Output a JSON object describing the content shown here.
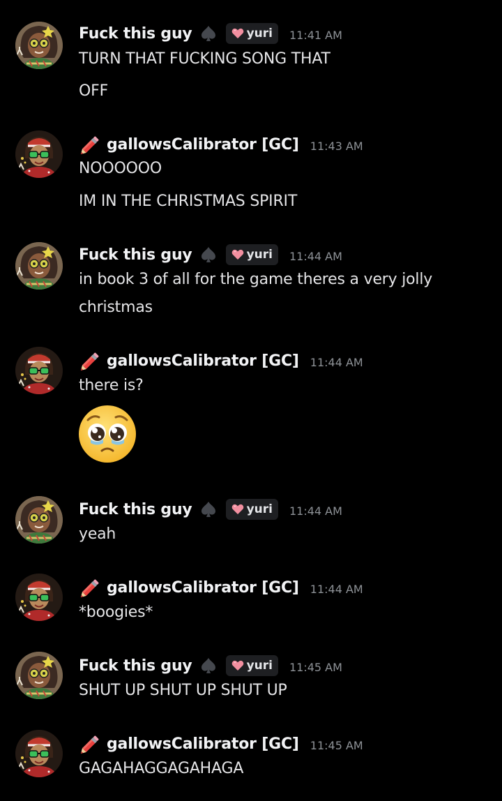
{
  "colors": {
    "background": "#000000",
    "text": "#e6e6e8",
    "timestamp": "#8e9297",
    "tag_bg": "#1e1f22",
    "heart": "#f28fa0",
    "pencil": "#e8413e"
  },
  "users": {
    "a": {
      "name": "Fuck this guy",
      "badge_icon": "spade-icon",
      "tag": "yuri",
      "tag_icon": "heart-icon"
    },
    "b": {
      "name": "gallowsCalibrator [GC]",
      "prefix_icon": "red-pencil-icon"
    }
  },
  "messages": [
    {
      "author": "Fuck this guy",
      "time": "11:41 AM",
      "lines": [
        "TURN THAT FUCKING SONG THAT",
        "OFF"
      ]
    },
    {
      "author": "gallowsCalibrator [GC]",
      "time": "11:43 AM",
      "lines": [
        "NOOOOOO",
        "IM IN THE CHRISTMAS SPIRIT"
      ]
    },
    {
      "author": "Fuck this guy",
      "time": "11:44 AM",
      "lines": [
        "in book 3 of all for the game theres a very jolly",
        "christmas"
      ]
    },
    {
      "author": "gallowsCalibrator [GC]",
      "time": "11:44 AM",
      "lines": [
        "there is?"
      ],
      "emoji": "pleading-face-emoji"
    },
    {
      "author": "Fuck this guy",
      "time": "11:44 AM",
      "lines": [
        "yeah"
      ]
    },
    {
      "author": "gallowsCalibrator [GC]",
      "time": "11:44 AM",
      "lines": [
        "*boogies*"
      ]
    },
    {
      "author": "Fuck this guy",
      "time": "11:45 AM",
      "lines": [
        "SHUT UP SHUT UP SHUT UP"
      ]
    },
    {
      "author": "gallowsCalibrator [GC]",
      "time": "11:45 AM",
      "lines": [
        "GAGAHAGGAGAHAGA"
      ]
    }
  ]
}
